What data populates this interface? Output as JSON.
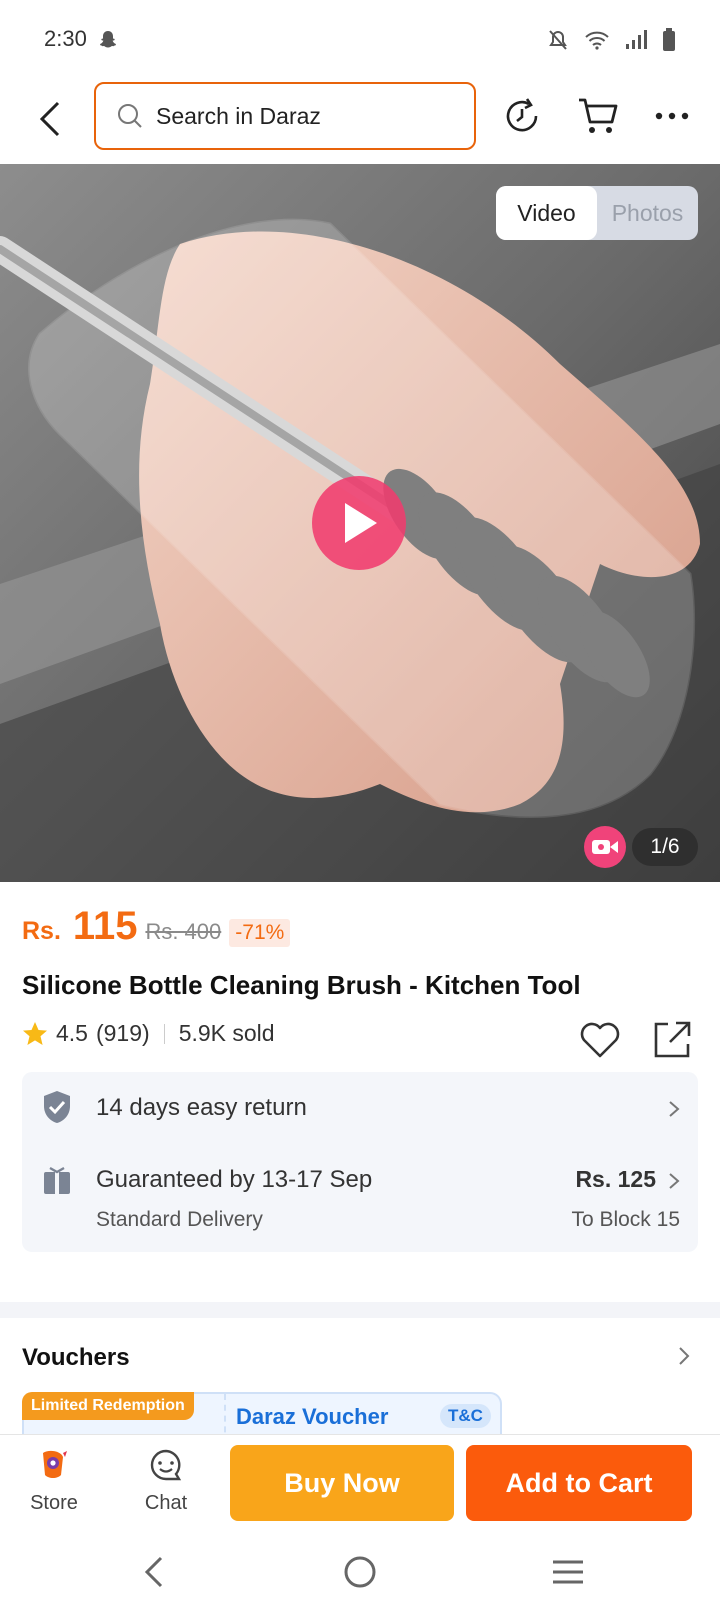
{
  "status_bar": {
    "time": "2:30"
  },
  "header": {
    "search": {
      "placeholder": "Search in Daraz"
    }
  },
  "gallery": {
    "tabs": [
      {
        "label": "Video",
        "active": true
      },
      {
        "label": "Photos",
        "active": false
      }
    ],
    "counter": "1/6"
  },
  "product": {
    "currency": "Rs.",
    "price": "115",
    "old_price": "Rs. 400",
    "discount": "-71%",
    "title": "Silicone Bottle Cleaning Brush - Kitchen Tool",
    "rating": "4.5",
    "reviews": "(919)",
    "sold": "5.9K sold"
  },
  "services": {
    "return": {
      "label": "14 days easy return"
    },
    "delivery": {
      "label": "Guaranteed by 13-17 Sep",
      "sub": "Standard Delivery",
      "price": "Rs. 125",
      "location": "To Block 15"
    }
  },
  "vouchers": {
    "title": "Vouchers",
    "tag": "Limited Redemption",
    "name": "Daraz Voucher",
    "tc": "T&C"
  },
  "bottom_bar": {
    "store_label": "Store",
    "chat_label": "Chat",
    "buy_now": "Buy Now",
    "add_to_cart": "Add to Cart"
  },
  "colors": {
    "accent": "#f36b12",
    "buy_now": "#f9a51a",
    "add_to_cart": "#fb5b0c",
    "voucher_blue": "#1a6fd8"
  }
}
